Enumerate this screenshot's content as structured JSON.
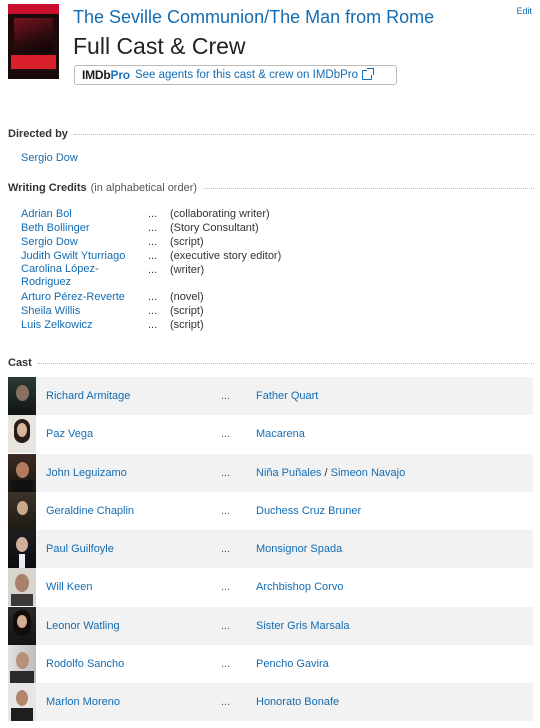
{
  "header": {
    "series_title": "The Seville Communion/The Man from Rome",
    "page_title": "Full Cast & Crew",
    "edit_label": "Edit",
    "imdbpro_logo_part1": "IMDb",
    "imdbpro_logo_part2": "Pro",
    "imdbpro_text": "See agents for this cast & crew on IMDbPro",
    "poster_icon": "movie-poster"
  },
  "directed_by": {
    "heading": "Directed by",
    "director": "Sergio Dow"
  },
  "writing": {
    "heading": "Writing Credits",
    "subheading": "(in alphabetical order)",
    "dots": "...",
    "rows": [
      {
        "name": "Adrian Bol",
        "credit": "(collaborating writer)"
      },
      {
        "name": "Beth Bollinger",
        "credit": "(Story Consultant)"
      },
      {
        "name": "Sergio Dow",
        "credit": "(script)"
      },
      {
        "name": "Judith Gwilt Yturriago",
        "credit": "(executive story editor)"
      },
      {
        "name": "Carolina López-Rodriguez",
        "credit": "(writer)"
      },
      {
        "name": "Arturo Pérez-Reverte",
        "credit": "(novel)"
      },
      {
        "name": "Sheila Willis",
        "credit": "(script)"
      },
      {
        "name": "Luis Zelkowicz",
        "credit": "(script)"
      }
    ]
  },
  "cast": {
    "heading": "Cast",
    "dots": "...",
    "rows": [
      {
        "actor": "Richard Armitage",
        "character": "Father Quart"
      },
      {
        "actor": "Paz Vega",
        "character": "Macarena"
      },
      {
        "actor": "John Leguizamo",
        "character": "Niña Puñales",
        "character2": "Simeon Navajo",
        "separator": "/"
      },
      {
        "actor": "Geraldine Chaplin",
        "character": "Duchess Cruz Bruner"
      },
      {
        "actor": "Paul Guilfoyle",
        "character": "Monsignor Spada"
      },
      {
        "actor": "Will Keen",
        "character": "Archbishop Corvo"
      },
      {
        "actor": "Leonor Watling",
        "character": "Sister Gris Marsala"
      },
      {
        "actor": "Rodolfo Sancho",
        "character": "Pencho Gavira"
      },
      {
        "actor": "Marlon Moreno",
        "character": "Honorato Bonafe"
      }
    ]
  },
  "colors": {
    "link": "#136cb2",
    "row_alt": "#f2f2f2",
    "imdbpro_blue": "#1f74bf"
  }
}
